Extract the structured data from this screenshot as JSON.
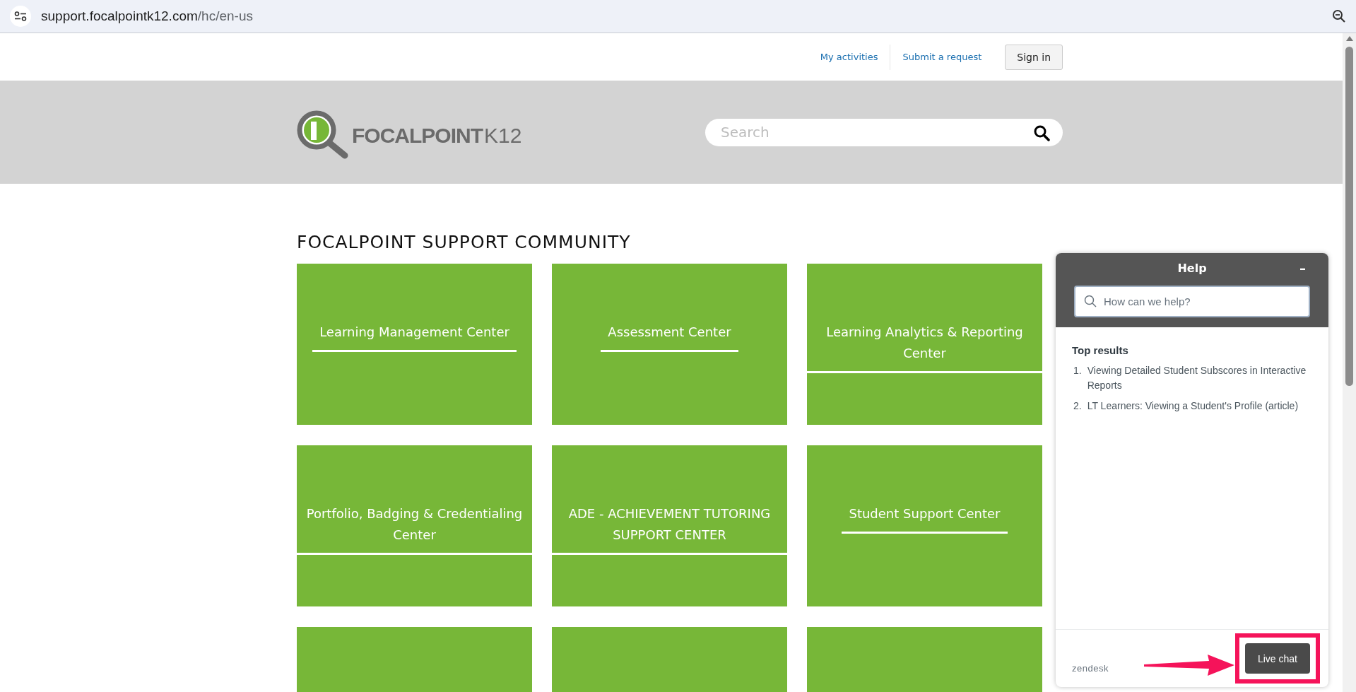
{
  "browser": {
    "url_host": "support.focalpointk12.com",
    "url_path": "/hc/en-us"
  },
  "top_nav": {
    "links": [
      "My activities",
      "Submit a request"
    ],
    "sign_in": "Sign in"
  },
  "header": {
    "logo_text": "FOCALPOINT",
    "logo_suffix": "K12",
    "search": {
      "placeholder": "Search"
    }
  },
  "section_title": "FOCALPOINT SUPPORT COMMUNITY",
  "tiles": [
    {
      "kind": "category",
      "title": "Learning Management Center"
    },
    {
      "kind": "category",
      "title": "Assessment Center"
    },
    {
      "kind": "category",
      "title": "Learning Analytics & Reporting Center"
    },
    {
      "kind": "category",
      "title": "Portfolio, Badging & Credentialing Center"
    },
    {
      "kind": "category",
      "title": "ADE - ACHIEVEMENT TUTORING SUPPORT CENTER"
    },
    {
      "kind": "category",
      "title": "Student Support Center"
    },
    {
      "kind": "blank"
    },
    {
      "kind": "blank"
    },
    {
      "kind": "blank"
    }
  ],
  "help_widget": {
    "title": "Help",
    "minimize": "–",
    "search": {
      "placeholder": "How can we help?"
    },
    "results_title": "Top results",
    "results": [
      {
        "number": "1.",
        "text": "Viewing Detailed Student Subscores in Interactive Reports"
      },
      {
        "number": "2.",
        "text": "LT Learners: Viewing a Student's Profile (article)"
      }
    ],
    "brand": "zendesk",
    "live_chat": "Live chat",
    "live_chat_highlighted": true
  }
}
